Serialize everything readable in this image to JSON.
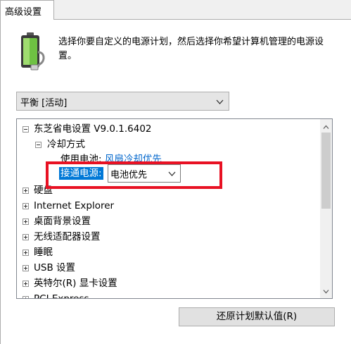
{
  "tab": {
    "label": "高级设置"
  },
  "description": "选择你要自定义的电源计划，然后选择你希望计算机管理的电源设置。",
  "plan_select": {
    "value": "平衡 [活动]"
  },
  "tree": {
    "root": "东芝省电设置 V9.0.1.6402",
    "child": "冷却方式",
    "battery_label": "使用电池:",
    "battery_value": "风扇冷却优先",
    "plugged_label": "接通电源:",
    "plugged_value": "电池优先",
    "items": [
      "硬盘",
      "Internet Explorer",
      "桌面背景设置",
      "无线适配器设置",
      "睡眠",
      "USB 设置",
      "英特尔(R) 显卡设置",
      "PCI Express"
    ]
  },
  "restore_button": {
    "label": "还原计划默认值(R)"
  },
  "colors": {
    "selection": "#0078d7",
    "highlight_box": "#e81123",
    "link": "#0066cc"
  },
  "icons": {
    "battery": "battery-plug-icon"
  }
}
